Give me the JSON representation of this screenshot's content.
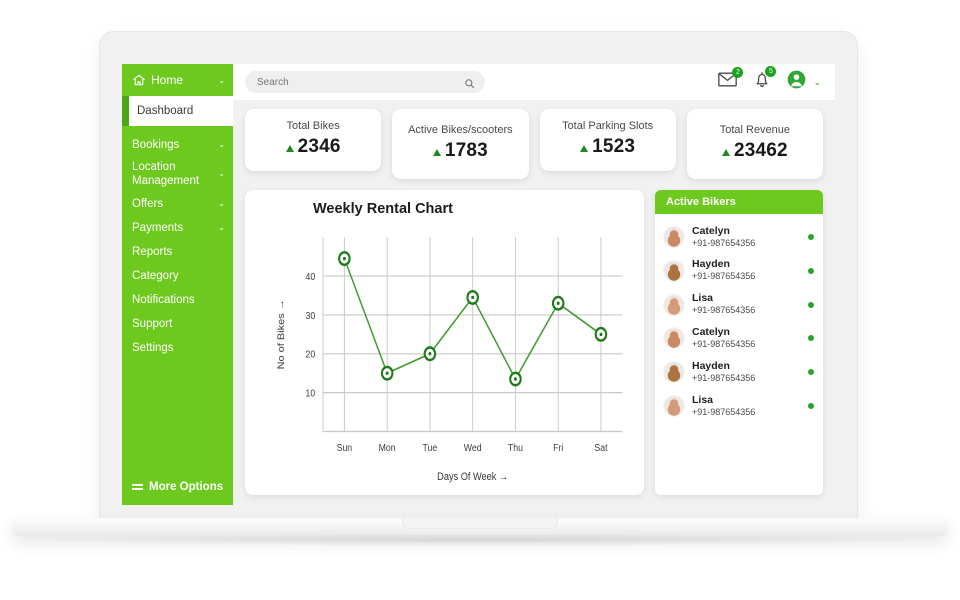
{
  "sidebar": {
    "home": {
      "label": "Home",
      "icon": "home-icon",
      "caret": "⌄"
    },
    "active_item": "Dashboard",
    "items": [
      {
        "label": "Bookings",
        "caret": "⌄",
        "has_caret": true
      },
      {
        "label": "Location Management",
        "caret": "⌄",
        "has_caret": true
      },
      {
        "label": "Offers",
        "caret": "⌄",
        "has_caret": true
      },
      {
        "label": "Payments",
        "caret": "⌄",
        "has_caret": true
      },
      {
        "label": "Reports",
        "has_caret": false
      },
      {
        "label": "Category",
        "has_caret": false
      },
      {
        "label": "Notifications",
        "has_caret": false
      },
      {
        "label": "Support",
        "has_caret": false
      },
      {
        "label": "Settings",
        "has_caret": false
      }
    ],
    "more_options": "More Options",
    "bg_color": "#6ec91e",
    "active_accent_color": "#4ba617"
  },
  "topbar": {
    "search": {
      "placeholder": "Search",
      "value": "",
      "icon": "search-icon"
    },
    "mail": {
      "icon": "envelope-icon",
      "badge": "2"
    },
    "notifications": {
      "icon": "bell-icon",
      "badge": "5"
    },
    "account": {
      "icon": "user-avatar-icon",
      "caret": "⌄"
    },
    "badge_color": "#17a31b"
  },
  "stats": [
    {
      "title": "Total Bikes",
      "value": "2346",
      "trend": "up"
    },
    {
      "title": "Active Bikes/scooters",
      "value": "1783",
      "trend": "up"
    },
    {
      "title": "Total Parking Slots",
      "value": "1523",
      "trend": "up"
    },
    {
      "title": "Total Revenue",
      "value": "23462",
      "trend": "up"
    }
  ],
  "chart_data": {
    "type": "line",
    "title": "Weekly Rental Chart",
    "xlabel": "Days Of Week →",
    "ylabel": "No of Bikes →",
    "categories": [
      "Sun",
      "Mon",
      "Tue",
      "Wed",
      "Thu",
      "Fri",
      "Sat"
    ],
    "values": [
      44.5,
      15,
      20,
      34.5,
      13.5,
      33,
      25
    ],
    "yticks": [
      10,
      20,
      30,
      40
    ],
    "ylim": [
      0,
      50
    ],
    "grid": true,
    "legend": "none",
    "line_color": "#3f9d2f",
    "marker_color": "#1c7a18"
  },
  "bikers_panel": {
    "header": "Active Bikers",
    "bikers": [
      {
        "name": "Catelyn",
        "phone": "+91-987654356",
        "status": "online"
      },
      {
        "name": "Hayden",
        "phone": "+91-987654356",
        "status": "online"
      },
      {
        "name": "Lisa",
        "phone": "+91-987654356",
        "status": "online"
      },
      {
        "name": "Catelyn",
        "phone": "+91-987654356",
        "status": "online"
      },
      {
        "name": "Hayden",
        "phone": "+91-987654356",
        "status": "online"
      },
      {
        "name": "Lisa",
        "phone": "+91-987654356",
        "status": "online"
      }
    ],
    "status_color": "#2aa328"
  }
}
